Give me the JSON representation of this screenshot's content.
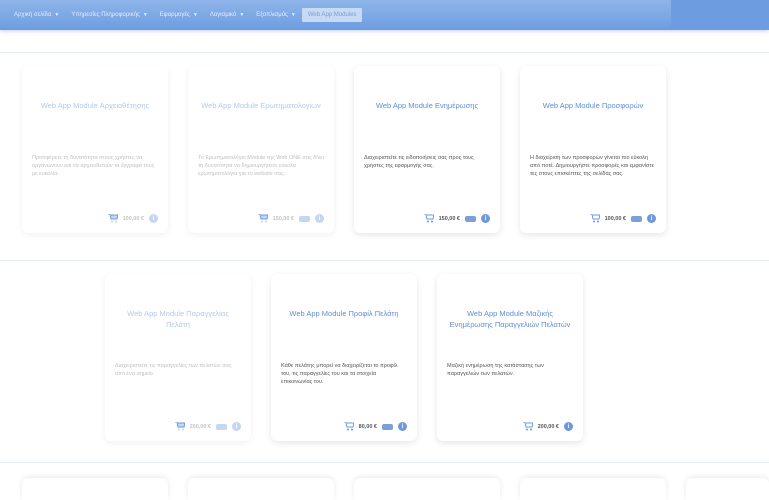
{
  "nav": {
    "items": [
      {
        "label": "Αρχική σελίδα"
      },
      {
        "label": "Υπηρεσίες Πληροφορικής"
      },
      {
        "label": "Εφαρμογές"
      },
      {
        "label": "Λογισμικό"
      },
      {
        "label": "Εξοπλισμός"
      },
      {
        "label": "Web App Modules"
      }
    ],
    "active_index": 5,
    "active_label": "Web App Modules"
  },
  "cards_row1": [
    {
      "title": "Web App Module Αρχειοθέτησης",
      "desc": "Προσφέρετε τη δυνατότητα στους χρήστες να οργανώνουν και να αρχειοθετούν τα έγγραφά τους με ευκολία.",
      "price": "100,00 €",
      "faded": true
    },
    {
      "title": "Web App Module Ερωτηματολογίων",
      "desc": "Το Ερωτηματολόγιο Module της Web ONE σας δίνει τη δυνατότητα να δημιουργήσετε εύκολα ερωτηματολόγια για το website σας.",
      "price": "150,00 €",
      "faded": true
    },
    {
      "title": "Web App Module Ενημέρωσης",
      "desc": "Διαχειριστείτε τις ειδοποιήσεις σας προς τους χρήστες της εφαρμογής σας.",
      "price": "150,00 €",
      "faded": false
    },
    {
      "title": "Web App Module Προσφορών",
      "desc": "Η διαχείριση των προσφορών γίνεται πιο εύκολη από ποτέ. Δημιουργήστε προσφορές και εμφανίστε τες στους επισκέπτες της σελίδας σας.",
      "price": "100,00 €",
      "faded": false
    }
  ],
  "cards_row2": [
    {
      "title": "Web App Module Παραγγελίας Πελάτη",
      "desc": "Διαχειριστείτε τις παραγγελίες των πελατών σας από ένα σημείο.",
      "price": "200,00 €",
      "faded": true
    },
    {
      "title": "Web App Module Προφίλ Πελάτη",
      "desc": "Κάθε πελάτης μπορεί να διαχειρίζεται το προφίλ του, τις παραγγελίες του και τα στοιχεία επικοινωνίας του.",
      "price": "80,00 €",
      "faded": false
    },
    {
      "title": "Web App Module Μαζικής Ενημέρωσης Παραγγελιών Πελατών",
      "desc": "Μαζική ενημέρωση της κατάστασης των παραγγελιών των πελατών.",
      "price": "200,00 €",
      "faded": false
    }
  ]
}
